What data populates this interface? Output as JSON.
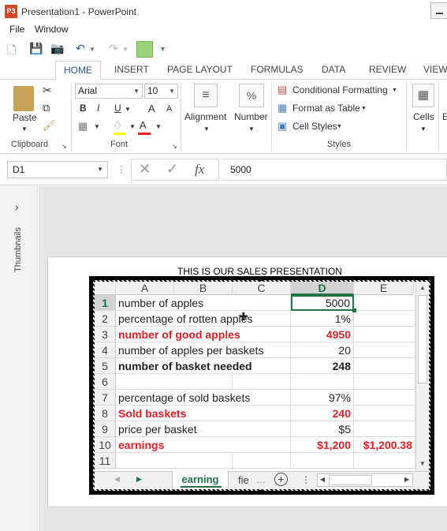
{
  "window": {
    "title": "Presentation1 - PowerPoint",
    "app_icon": "P3"
  },
  "menu": [
    "File",
    "Window"
  ],
  "tabs": [
    "HOME",
    "INSERT",
    "PAGE LAYOUT",
    "FORMULAS",
    "DATA",
    "REVIEW",
    "VIEW"
  ],
  "ribbon": {
    "paste": "Paste",
    "clipboard": "Clipboard",
    "font_name": "Arial",
    "font_size": "10",
    "bold": "B",
    "italic": "I",
    "underline": "U",
    "grow": "A",
    "shrink": "A",
    "font_color": "A",
    "font": "Font",
    "alignment": "Alignment",
    "number": "Number",
    "percent": "%",
    "conditional": "Conditional Formatting",
    "format_table": "Format as Table",
    "cell_styles": "Cell Styles",
    "styles": "Styles",
    "cells": "Cells",
    "cut_off": "E"
  },
  "formula_bar": {
    "name_box": "D1",
    "fx": "fx",
    "value": "5000"
  },
  "left_panel": {
    "expand": "›",
    "label": "Thumbnails"
  },
  "slide": {
    "title": "THIS IS OUR SALES PRESENTATION"
  },
  "sheet": {
    "columns": [
      "A",
      "B",
      "C",
      "D",
      "E"
    ],
    "rows": [
      {
        "n": "1",
        "a": "number of apples",
        "d": "5000",
        "e": "",
        "style": ""
      },
      {
        "n": "2",
        "a": "percentage of rotten apples",
        "d": "1%",
        "e": "",
        "style": ""
      },
      {
        "n": "3",
        "a": "number of good apples",
        "d": "4950",
        "e": "",
        "style": "red"
      },
      {
        "n": "4",
        "a": "number of apples per baskets",
        "d": "20",
        "e": "",
        "style": ""
      },
      {
        "n": "5",
        "a": "number of basket needed",
        "d": "248",
        "e": "",
        "style": "bold"
      },
      {
        "n": "6",
        "a": "",
        "d": "",
        "e": "",
        "style": ""
      },
      {
        "n": "7",
        "a": "percentage of sold baskets",
        "d": "97%",
        "e": "",
        "style": ""
      },
      {
        "n": "8",
        "a": "Sold baskets",
        "d": "240",
        "e": "",
        "style": "red"
      },
      {
        "n": "9",
        "a": "price per basket",
        "d": "$5",
        "e": "",
        "style": ""
      },
      {
        "n": "10",
        "a": "earnings",
        "d": "$1,200",
        "e": "$1,200.38",
        "style": "red"
      },
      {
        "n": "11",
        "a": "",
        "d": "",
        "e": "",
        "style": ""
      }
    ],
    "active_tab": "earning",
    "other_tab": "fie",
    "selected_cell": "D1"
  },
  "colors": {
    "accent": "#2b579a",
    "excel_green": "#217346",
    "red": "#e31e24"
  }
}
